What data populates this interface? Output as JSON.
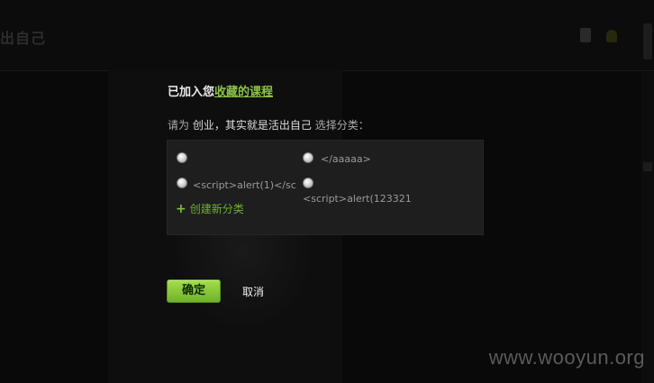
{
  "background": {
    "header_title": "出自己"
  },
  "dialog": {
    "title_prefix": "已加入您",
    "title_link": "收藏的课程",
    "prompt_prefix": "请为",
    "course_name": "创业，其实就是活出自己",
    "prompt_suffix": "选择分类：",
    "categories": [
      {
        "label": ""
      },
      {
        "label": "</aaaaa>"
      },
      {
        "label": "<script>alert(1)</sc"
      },
      {
        "label": "<script>alert(123321"
      }
    ],
    "add_category_label": "创建新分类",
    "confirm_label": "确定",
    "cancel_label": "取消"
  },
  "watermark": "www.wooyun.org",
  "colors": {
    "accent_green": "#8bc34a",
    "button_green": "#7cbd31",
    "dialog_box": "#1e1e1e"
  }
}
